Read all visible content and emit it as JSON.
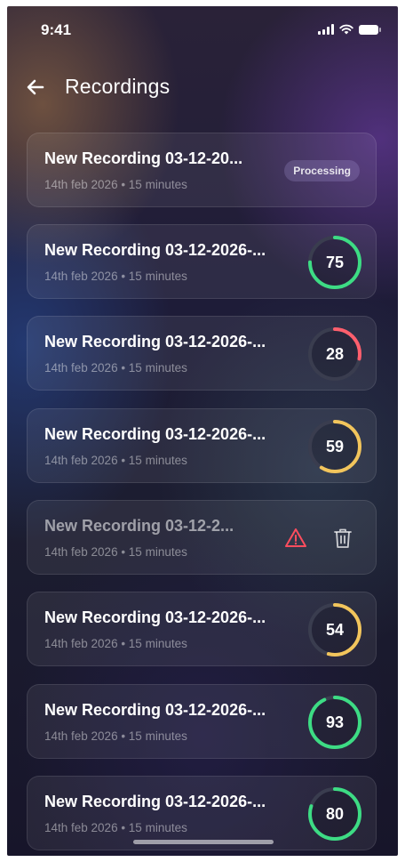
{
  "status_bar": {
    "time": "9:41",
    "icons": [
      "cellular-signal-icon",
      "wifi-icon",
      "battery-icon"
    ]
  },
  "header": {
    "back_icon": "arrow-left-icon",
    "title": "Recordings"
  },
  "recordings": [
    {
      "title": "New Recording 03-12-20...",
      "meta": "14th feb 2026 • 15 minutes",
      "state": "processing",
      "badge": "Processing"
    },
    {
      "title": "New Recording 03-12-2026-...",
      "meta": "14th feb 2026 • 15 minutes",
      "state": "scored",
      "score": 75
    },
    {
      "title": "New Recording 03-12-2026-...",
      "meta": "14th feb 2026 • 15 minutes",
      "state": "scored",
      "score": 28
    },
    {
      "title": "New Recording 03-12-2026-...",
      "meta": "14th feb 2026 • 15 minutes",
      "state": "scored",
      "score": 59
    },
    {
      "title": "New Recording 03-12-2...",
      "meta": "14th feb 2026 • 15 minutes",
      "state": "error",
      "icons": [
        "warning-icon",
        "trash-icon"
      ]
    },
    {
      "title": "New Recording 03-12-2026-...",
      "meta": "14th feb 2026 • 15 minutes",
      "state": "scored",
      "score": 54
    },
    {
      "title": "New Recording 03-12-2026-...",
      "meta": "14th feb 2026 • 15 minutes",
      "state": "scored",
      "score": 93
    },
    {
      "title": "New Recording 03-12-2026-...",
      "meta": "14th feb 2026 • 15 minutes",
      "state": "scored",
      "score": 80
    }
  ],
  "colors": {
    "score_high": "#3ddc84",
    "score_mid": "#f2c55c",
    "score_low": "#ff5f6d",
    "ring_track": "#3a3d4f",
    "warning": "#ff4d5e"
  }
}
